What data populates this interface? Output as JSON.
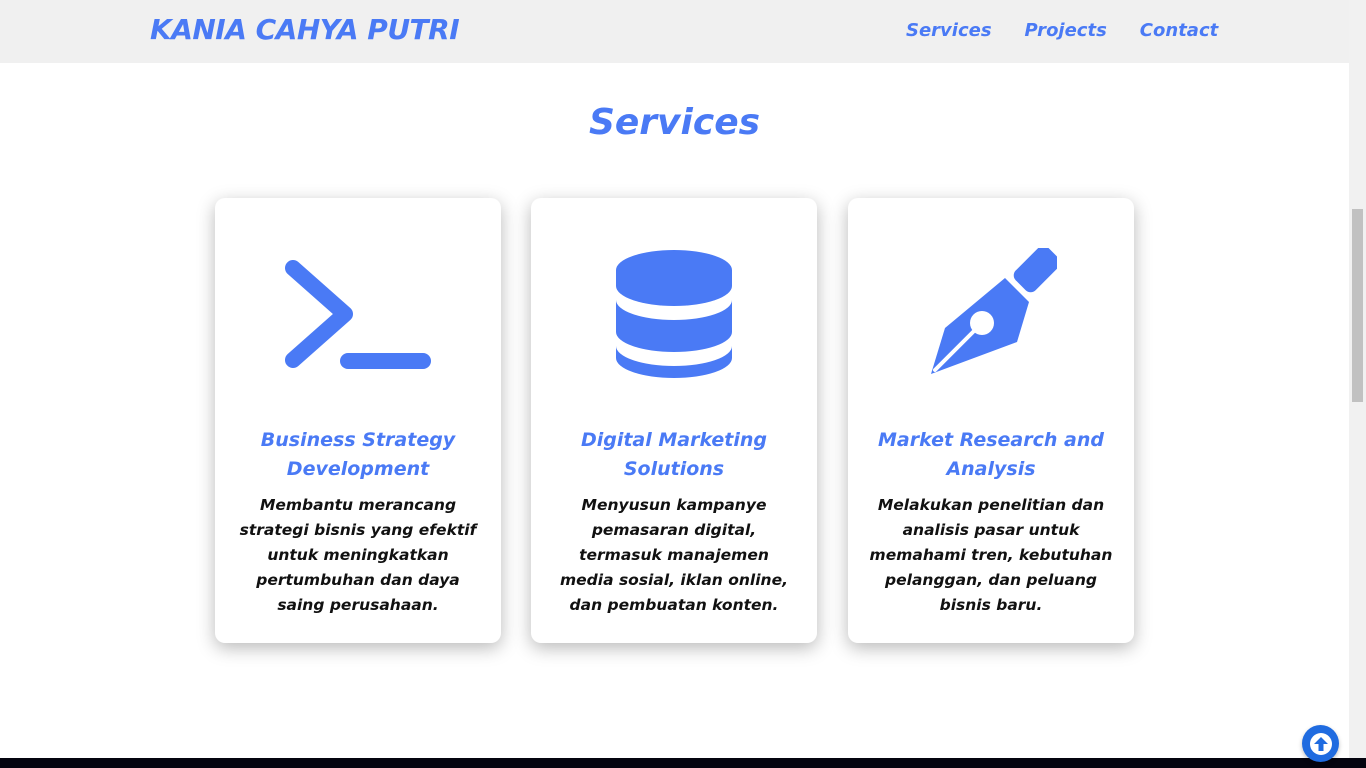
{
  "brand": "KANIA CAHYA PUTRI",
  "nav": [
    "Services",
    "Projects",
    "Contact"
  ],
  "section_title": "Services",
  "cards": [
    {
      "icon": "terminal-icon",
      "title": "Business Strategy Development",
      "text": "Membantu merancang strategi bisnis yang efektif untuk meningkatkan pertumbuhan dan daya saing perusahaan."
    },
    {
      "icon": "database-icon",
      "title": "Digital Marketing Solutions",
      "text": "Menyusun kampanye pemasaran digital, termasuk manajemen media sosial, iklan online, dan pembuatan konten."
    },
    {
      "icon": "pen-nib-icon",
      "title": "Market Research and Analysis",
      "text": "Melakukan penelitian dan analisis pasar untuk memahami tren, kebutuhan pelanggan, dan peluang bisnis baru."
    }
  ],
  "back_to_top_icon": "arrow-up-icon",
  "colors": {
    "accent": "#4a7af5",
    "header_bg": "#f0f0f0",
    "button": "#1f6be0"
  }
}
